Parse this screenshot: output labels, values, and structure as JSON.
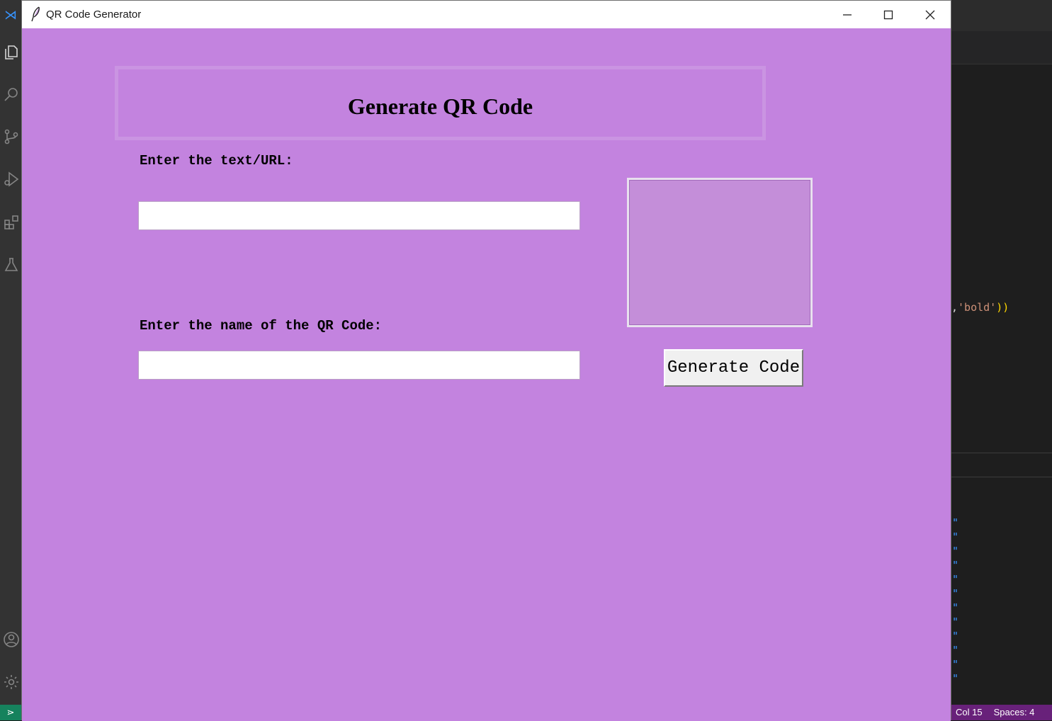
{
  "window": {
    "title": "QR Code Generator",
    "icon": "feather-icon",
    "controls": [
      "minimize-icon",
      "maximize-icon",
      "close-icon"
    ]
  },
  "app": {
    "heading": "Generate QR Code",
    "text_label": "Enter the text/URL:",
    "text_value": "",
    "name_label": "Enter the name of the QR Code:",
    "name_value": "",
    "generate_button": "Generate Code",
    "background_color": "#c383df"
  },
  "editor_background": {
    "code_fragment_punct": ",",
    "code_fragment_string": "'bold'",
    "code_fragment_paren": "))",
    "quote_glyph": "\"",
    "status": {
      "column": "Col 15",
      "spaces": "Spaces: 4"
    },
    "activity_icons": [
      "explorer-icon",
      "search-icon",
      "source-control-icon",
      "run-debug-icon",
      "extensions-icon",
      "testing-icon",
      "account-icon",
      "settings-gear-icon"
    ]
  }
}
